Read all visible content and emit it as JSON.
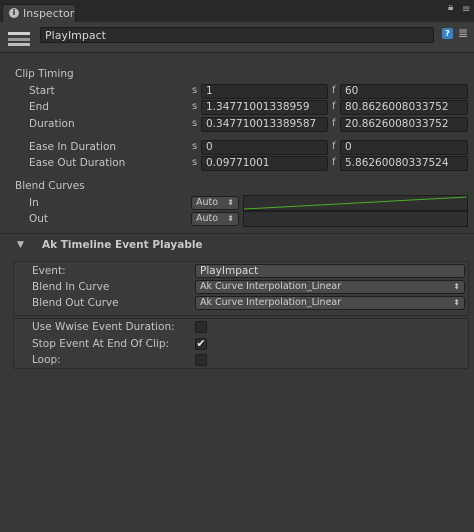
{
  "tab": {
    "label": "Inspector",
    "info_icon": "i"
  },
  "header": {
    "name": "PlayImpact"
  },
  "clip_timing": {
    "title": "Clip Timing",
    "rows": [
      {
        "label": "Start",
        "s_unit": "s",
        "s_value": "1",
        "f_unit": "f",
        "f_value": "60"
      },
      {
        "label": "End",
        "s_unit": "s",
        "s_value": "1.34771001338959",
        "f_unit": "f",
        "f_value": "80.8626008033752"
      },
      {
        "label": "Duration",
        "s_unit": "s",
        "s_value": "0.347710013389587",
        "f_unit": "f",
        "f_value": "20.8626008033752"
      },
      {
        "label": "Ease In Duration",
        "s_unit": "s",
        "s_value": "0",
        "f_unit": "f",
        "f_value": "0"
      },
      {
        "label": "Ease Out Duration",
        "s_unit": "s",
        "s_value": "0.09771001",
        "f_unit": "f",
        "f_value": "5.86260080337524"
      }
    ]
  },
  "blend_curves": {
    "title": "Blend Curves",
    "in_label": "In",
    "in_mode": "Auto",
    "out_label": "Out",
    "out_mode": "Auto",
    "curve_color": "#4caf2a"
  },
  "playable": {
    "title": "Ak Timeline Event Playable",
    "event_label": "Event:",
    "event_value": "PlayImpact",
    "blend_in_label": "Blend In Curve",
    "blend_in_value": "Ak Curve Interpolation_Linear",
    "blend_out_label": "Blend Out Curve",
    "blend_out_value": "Ak Curve Interpolation_Linear",
    "use_wwise_label": "Use Wwise Event Duration:",
    "use_wwise_checked": false,
    "stop_event_label": "Stop Event At End Of Clip:",
    "stop_event_checked": true,
    "loop_label": "Loop:",
    "loop_checked": false,
    "checkmark": "✔"
  }
}
